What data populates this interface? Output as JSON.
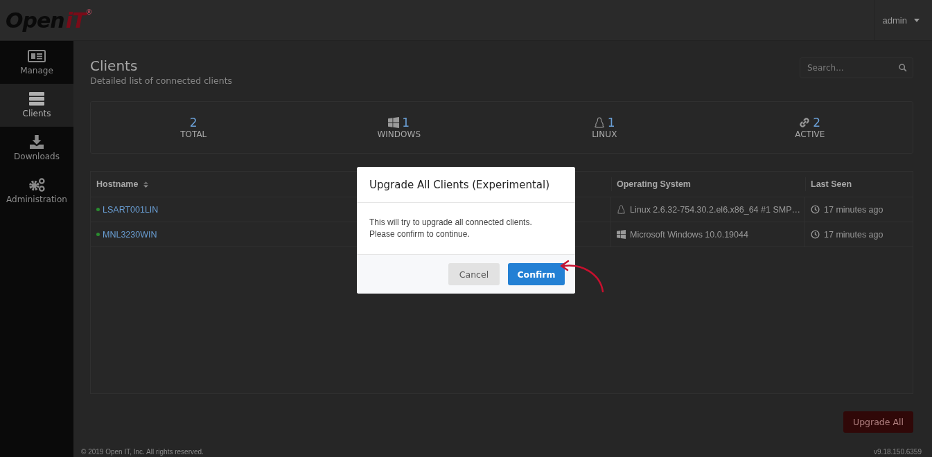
{
  "header": {
    "logo": {
      "word": "Open",
      "mark": "iT",
      "registered": "®"
    },
    "user_menu": "admin"
  },
  "sidebar": {
    "items": [
      {
        "label": "Manage",
        "kind": "manage",
        "selected": false
      },
      {
        "label": "Clients",
        "kind": "clients",
        "selected": true
      },
      {
        "label": "Downloads",
        "kind": "downloads",
        "selected": false
      },
      {
        "label": "Administration",
        "kind": "administration",
        "selected": false
      }
    ]
  },
  "page": {
    "title": "Clients",
    "subtitle": "Detailed list of connected clients",
    "search": {
      "placeholder": "Search..."
    }
  },
  "stats": [
    {
      "kind": "total",
      "value": "2",
      "label": "TOTAL"
    },
    {
      "kind": "windows",
      "value": "1",
      "label": "WINDOWS"
    },
    {
      "kind": "linux",
      "value": "1",
      "label": "LINUX"
    },
    {
      "kind": "active",
      "value": "2",
      "label": "ACTIVE"
    }
  ],
  "table": {
    "columns": [
      {
        "label": "Hostname",
        "sorted": true
      },
      {
        "label": "Operating System",
        "sorted": false
      },
      {
        "label": "Last Seen",
        "sorted": false
      }
    ],
    "rows": [
      {
        "hostname": "LSART001LIN",
        "color": "#2a8c2f",
        "kind": "linux",
        "os": "Linux 2.6.32-754.30.2.el6.x86_64 #1 SMP…",
        "last_seen": "17 minutes ago"
      },
      {
        "hostname": "MNL3230WIN",
        "color": "#2a8c2f",
        "kind": "windows",
        "os": "Microsoft Windows 10.0.19044",
        "last_seen": "17 minutes ago"
      }
    ]
  },
  "actions": {
    "upgrade_all": "Upgrade All"
  },
  "footer": {
    "copyright": "© 2019 Open IT, Inc. All rights reserved.",
    "version": "v9.18.150.6359"
  },
  "dialog": {
    "title": "Upgrade All Clients (Experimental)",
    "message_lines": [
      "This will try to upgrade all connected clients.",
      "Please confirm to continue."
    ],
    "buttons": [
      {
        "label": "Cancel",
        "kind": "secondary"
      },
      {
        "label": "Confirm",
        "kind": "primary"
      }
    ]
  }
}
